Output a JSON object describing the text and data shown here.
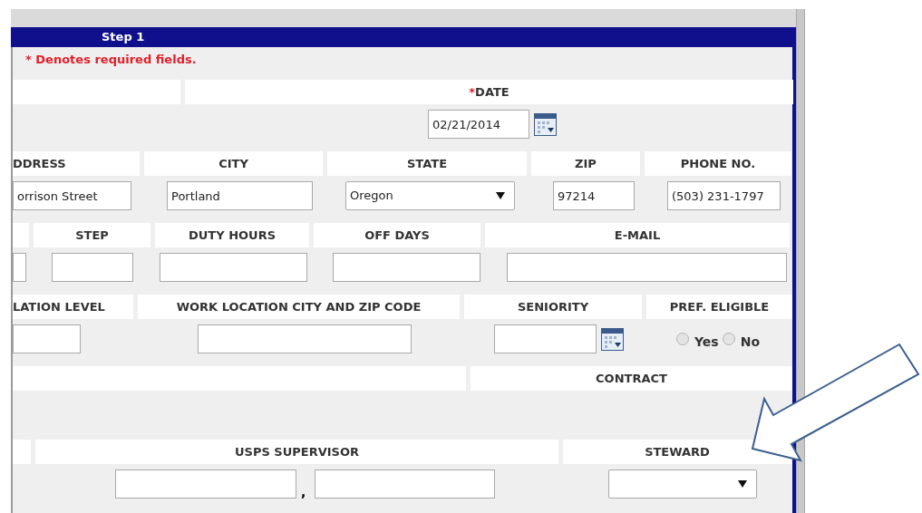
{
  "panel": {
    "title": "Step 1"
  },
  "required_note": "* Denotes required fields.",
  "sections": [
    {
      "headers": [
        {
          "label": "DATE",
          "required_mark": "*"
        }
      ],
      "controls": [
        {
          "kind": "date",
          "value": "02/21/2014"
        }
      ]
    },
    {
      "headers": [
        {
          "label": "DDRESS"
        },
        {
          "label": "CITY"
        },
        {
          "label": "STATE"
        },
        {
          "label": "ZIP"
        },
        {
          "label": "PHONE NO."
        }
      ],
      "controls": [
        {
          "kind": "text",
          "value": "orrison Street"
        },
        {
          "kind": "text",
          "value": "Portland"
        },
        {
          "kind": "select",
          "value": "Oregon"
        },
        {
          "kind": "text",
          "value": "97214"
        },
        {
          "kind": "text",
          "value": "(503) 231-1797"
        }
      ]
    },
    {
      "headers": [
        {
          "label": "STEP"
        },
        {
          "label": "DUTY HOURS"
        },
        {
          "label": "OFF DAYS"
        },
        {
          "label": "E-MAIL"
        }
      ],
      "controls": [
        {
          "kind": "text"
        },
        {
          "kind": "text"
        },
        {
          "kind": "text"
        },
        {
          "kind": "text"
        },
        {
          "kind": "text"
        }
      ]
    },
    {
      "headers": [
        {
          "label": "LATION LEVEL"
        },
        {
          "label": "WORK LOCATION CITY AND ZIP CODE"
        },
        {
          "label": "SENIORITY"
        },
        {
          "label": "PREF. ELIGIBLE"
        }
      ],
      "controls": [
        {
          "kind": "text"
        },
        {
          "kind": "text"
        },
        {
          "kind": "date"
        },
        {
          "kind": "radio",
          "options": [
            {
              "label": "Yes",
              "selected": false
            },
            {
              "label": "No",
              "selected": false
            }
          ]
        }
      ]
    },
    {
      "headers": [
        {
          "label": "CONTRACT"
        }
      ]
    },
    {
      "headers": [
        {
          "label": "USPS SUPERVISOR"
        },
        {
          "label": "STEWARD"
        }
      ],
      "controls": [
        {
          "kind": "text"
        },
        {
          "kind": "separator",
          "text": ","
        },
        {
          "kind": "text"
        },
        {
          "kind": "select"
        }
      ]
    }
  ]
}
